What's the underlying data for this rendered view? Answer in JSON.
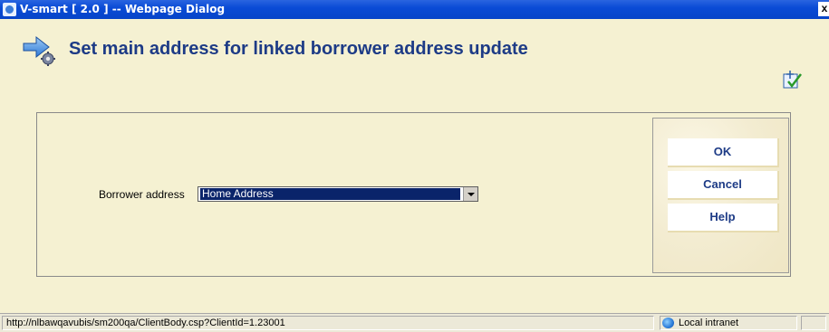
{
  "window": {
    "title": "V-smart [ 2.0 ] -- Webpage Dialog",
    "close_label": "x"
  },
  "dialog": {
    "title": "Set main address for linked borrower address update",
    "header_icon": "arrow-with-gear-icon",
    "corner_icon": "checklist-icon"
  },
  "form": {
    "borrower_address_label": "Borrower address",
    "borrower_address_value": "Home Address"
  },
  "buttons": {
    "ok": "OK",
    "cancel": "Cancel",
    "help": "Help"
  },
  "statusbar": {
    "url": "http://nlbawqavubis/sm200qa/ClientBody.csp?ClientId=1.23001",
    "zone": "Local intranet"
  },
  "colors": {
    "title_blue": "#1d3b86",
    "background": "#f5f1d2",
    "selection": "#0a246a"
  }
}
